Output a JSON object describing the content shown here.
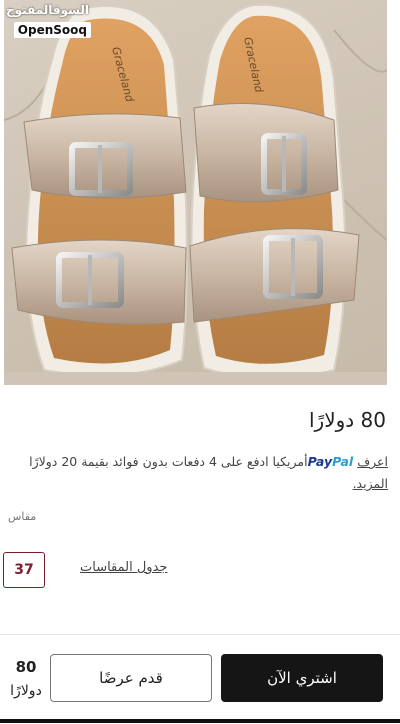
{
  "watermark": {
    "arabic": "السوقالمفتوح",
    "english": "OpenSooq"
  },
  "product_image": {
    "brand_text": "Graceland"
  },
  "price": {
    "amount": "80",
    "currency": "دولارًا"
  },
  "paypal_note": {
    "prefix": "اعرف",
    "logo_part1": "Pay",
    "logo_part2": "Pal",
    "text": "أمريكيا ادفع على 4 دفعات بدون فوائد بقيمة 20 دولارًا",
    "more": "المزيد."
  },
  "size": {
    "label": "مقاس",
    "selected": "37",
    "guide_link": "جدول المقاسات"
  },
  "footer": {
    "price_amount": "80",
    "price_currency": "دولارًا",
    "offer_button": "قدم عرضًا",
    "buy_button": "اشتري الآن"
  },
  "colors": {
    "accent": "#7a1f2b",
    "buy_button_bg": "#151515",
    "paypal_dark": "#1a3a8f",
    "paypal_light": "#2a9fd6"
  }
}
